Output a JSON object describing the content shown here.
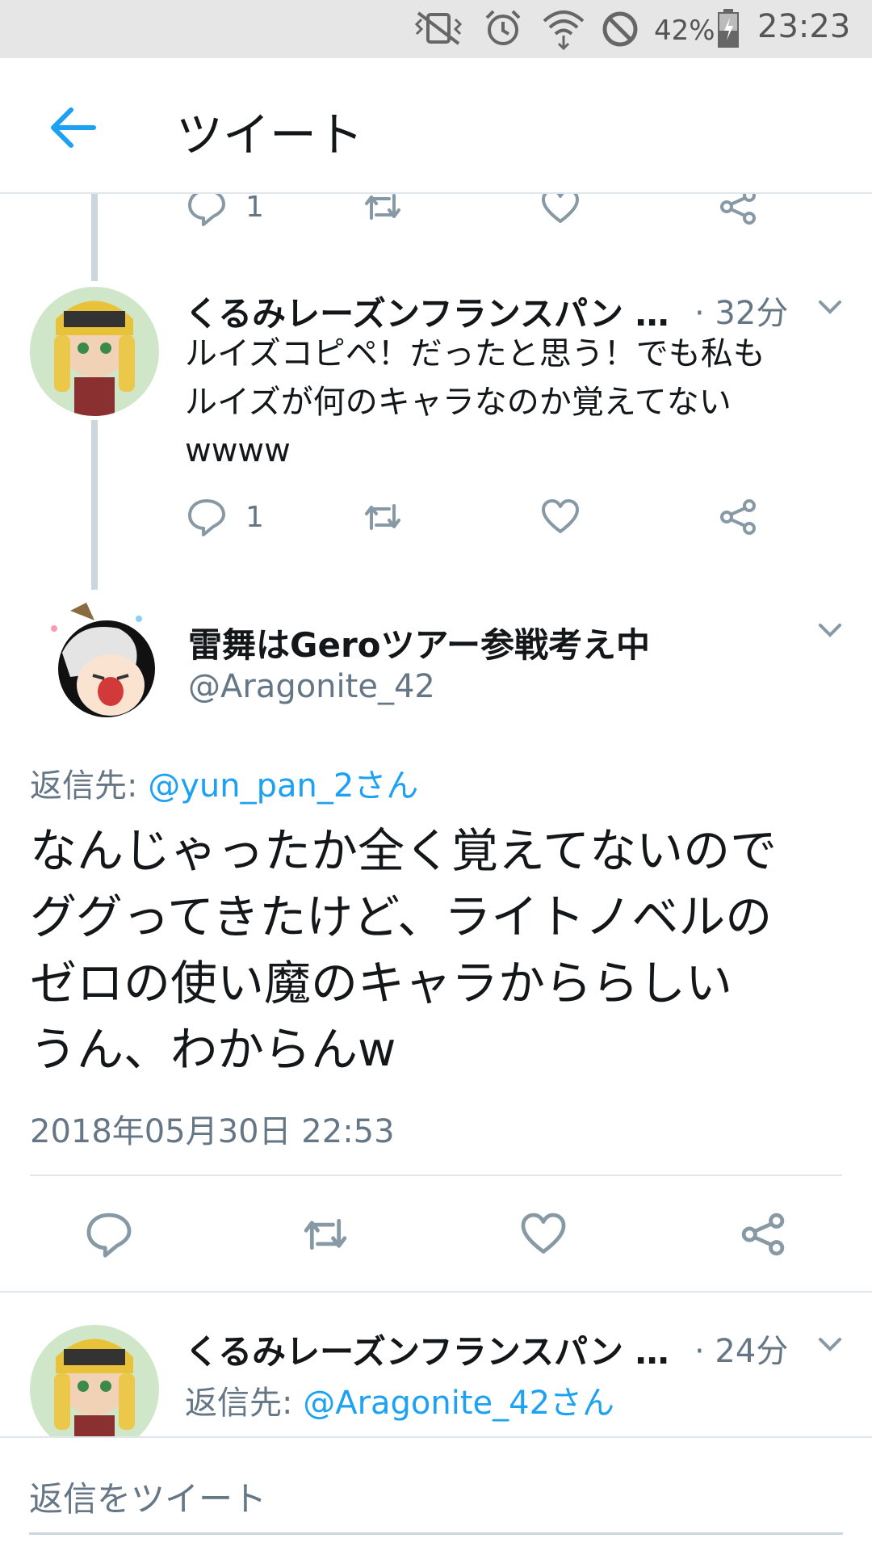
{
  "status_bar": {
    "battery": "42%",
    "time": "23:23",
    "icons": [
      "vibrate-icon",
      "alarm-icon",
      "wifi-icon",
      "do-not-disturb-icon",
      "battery-icon"
    ]
  },
  "header": {
    "back_icon": "arrow-left-icon",
    "title": "ツイート"
  },
  "top_actions": {
    "reply_count": "1"
  },
  "tweet1": {
    "name": "くるみレーズンフランスパン …",
    "time": "· 32分",
    "text_lines": [
      "ルイズコピペ！だったと思う！でも私も",
      "ルイズが何のキャラなのか覚えてない",
      "wwww"
    ],
    "reply_count": "1"
  },
  "main_tweet": {
    "name": "雷舞はGeroツアー参戦考え中",
    "handle": "@Aragonite_42",
    "reply_prefix": "返信先: ",
    "reply_to": "@yun_pan_2さん",
    "text_lines": [
      "なんじゃったか全く覚えてないので",
      "ググってきたけど、ライトノベルの",
      "ゼロの使い魔のキャラかららしい",
      "うん、わからんw"
    ],
    "timestamp": "2018年05月30日 22:53"
  },
  "tweet3": {
    "name": "くるみレーズンフランスパン …",
    "time": "· 24分",
    "reply_prefix": "返信先: ",
    "reply_to": "@Aragonite_42さん"
  },
  "reply_bar": {
    "placeholder": "返信をツイート"
  },
  "colors": {
    "accent": "#1da1f2",
    "secondary_text": "#657786",
    "divider": "#e1e8ed"
  }
}
